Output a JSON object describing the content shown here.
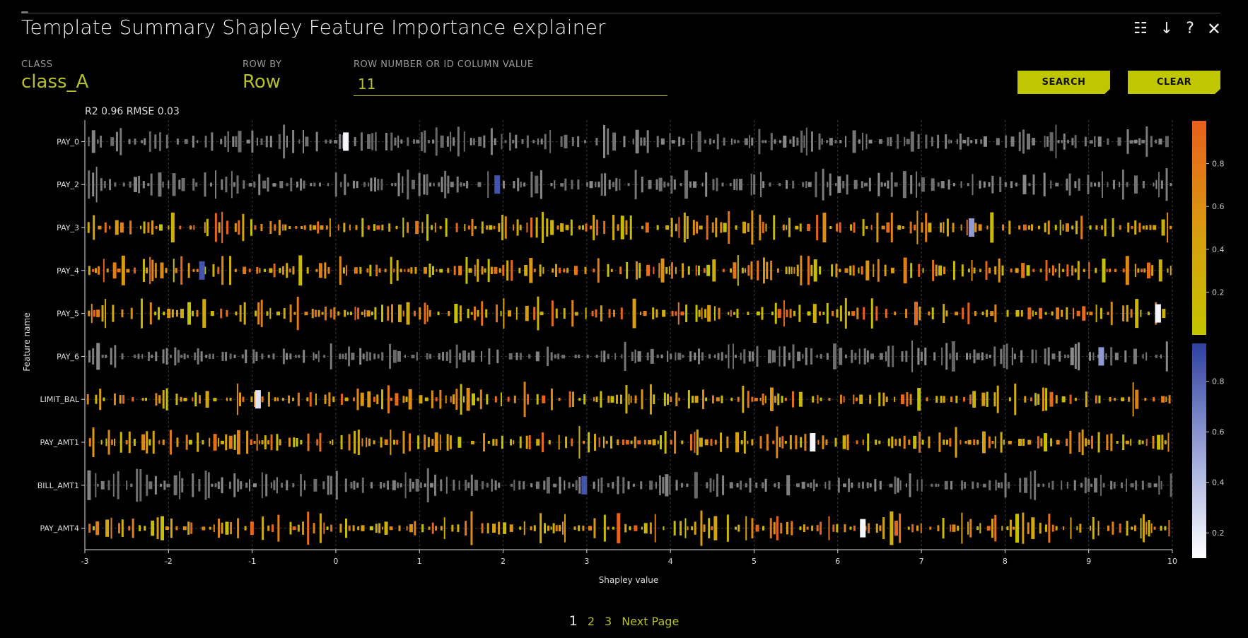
{
  "header": {
    "title": "Template Summary Shapley Feature Importance explainer",
    "icons": [
      "list-icon",
      "download-icon",
      "help-icon",
      "close-icon"
    ],
    "icon_glyphs": {
      "list": "☷",
      "download": "↓",
      "help": "?",
      "close": "✕"
    }
  },
  "controls": {
    "class_label": "CLASS",
    "class_value": "class_A",
    "rowby_label": "ROW BY",
    "rowby_value": "Row",
    "row_input_label": "ROW NUMBER OR ID COLUMN VALUE",
    "row_input_value": "11",
    "search_label": "SEARCH",
    "clear_label": "CLEAR"
  },
  "metrics": "R2 0.96 RMSE 0.03",
  "pagination": {
    "pages": [
      "1",
      "2",
      "3"
    ],
    "current": "1",
    "next_label": "Next Page"
  },
  "colors": {
    "accent": "#c0c600",
    "categorical_gray": "#7a7a7a",
    "orange_scale": [
      "#c4c400",
      "#d99a10",
      "#e85f1c"
    ],
    "blue_scale": [
      "#ffffff",
      "#9aa4d8",
      "#2f3fa0"
    ]
  },
  "chart_data": {
    "type": "scatter",
    "subtype": "shapley-beeswarm",
    "xlabel": "Shapley value",
    "ylabel": "Feature name",
    "xlim": [
      -3,
      10
    ],
    "x_ticks": [
      "-3",
      "-2",
      "-1",
      "0",
      "1",
      "2",
      "3",
      "4",
      "5",
      "6",
      "7",
      "8",
      "9",
      "10"
    ],
    "features": [
      "PAY_0",
      "PAY_2",
      "PAY_3",
      "PAY_4",
      "PAY_5",
      "PAY_6",
      "LIMIT_BAL",
      "PAY_AMT1",
      "BILL_AMT1",
      "PAY_AMT4"
    ],
    "feature_kind": [
      "categorical",
      "categorical",
      "numeric",
      "numeric",
      "numeric",
      "categorical",
      "numeric",
      "numeric",
      "categorical",
      "numeric"
    ],
    "highlighted_row": [
      {
        "feature": "PAY_0",
        "x": 0.12,
        "color_value": 0.05
      },
      {
        "feature": "PAY_2",
        "x": 1.93,
        "color_value": 0.9
      },
      {
        "feature": "PAY_3",
        "x": 7.6,
        "color_value": 0.55
      },
      {
        "feature": "PAY_4",
        "x": -1.6,
        "color_value": 0.9
      },
      {
        "feature": "PAY_5",
        "x": 9.83,
        "color_value": 0.05
      },
      {
        "feature": "PAY_6",
        "x": 9.15,
        "color_value": 0.55
      },
      {
        "feature": "LIMIT_BAL",
        "x": -0.93,
        "color_value": 0.15
      },
      {
        "feature": "PAY_AMT1",
        "x": 5.7,
        "color_value": 0.05
      },
      {
        "feature": "BILL_AMT1",
        "x": 2.97,
        "color_value": 0.9
      },
      {
        "feature": "PAY_AMT4",
        "x": 6.3,
        "color_value": 0.05
      }
    ],
    "colorbar_numeric": {
      "ticks": [
        "0.2",
        "0.4",
        "0.6",
        "0.8"
      ],
      "range": [
        0,
        1
      ]
    },
    "colorbar_categorical": {
      "ticks": [
        "0.2",
        "0.4",
        "0.6",
        "0.8"
      ],
      "range": [
        0.1,
        0.95
      ]
    },
    "grid": true
  }
}
